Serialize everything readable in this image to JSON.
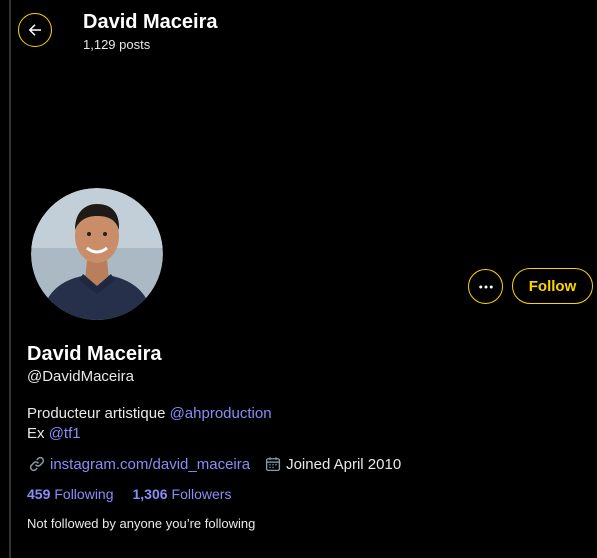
{
  "header": {
    "name": "David Maceira",
    "posts_count": "1,129 posts"
  },
  "profile": {
    "display_name": "David Maceira",
    "handle": "@DavidMaceira",
    "follow_label": "Follow",
    "bio": {
      "line1_text": "Producteur artistique ",
      "line1_mention": "@ahproduction",
      "line2_text": "Ex ",
      "line2_mention": "@tf1"
    },
    "website": "instagram.com/david_maceira",
    "joined": "Joined April 2010",
    "following_count": "459",
    "following_label": "Following",
    "followers_count": "1,306",
    "followers_label": "Followers",
    "not_followed_text": "Not followed by anyone you’re following"
  },
  "icons": {
    "back": "arrow-left-icon",
    "more": "more-horizontal-icon",
    "link": "link-icon",
    "calendar": "calendar-icon"
  },
  "colors": {
    "accent": "#ffd400",
    "link": "#8b8cf6",
    "background": "#000000",
    "text": "#e7e9ea"
  }
}
